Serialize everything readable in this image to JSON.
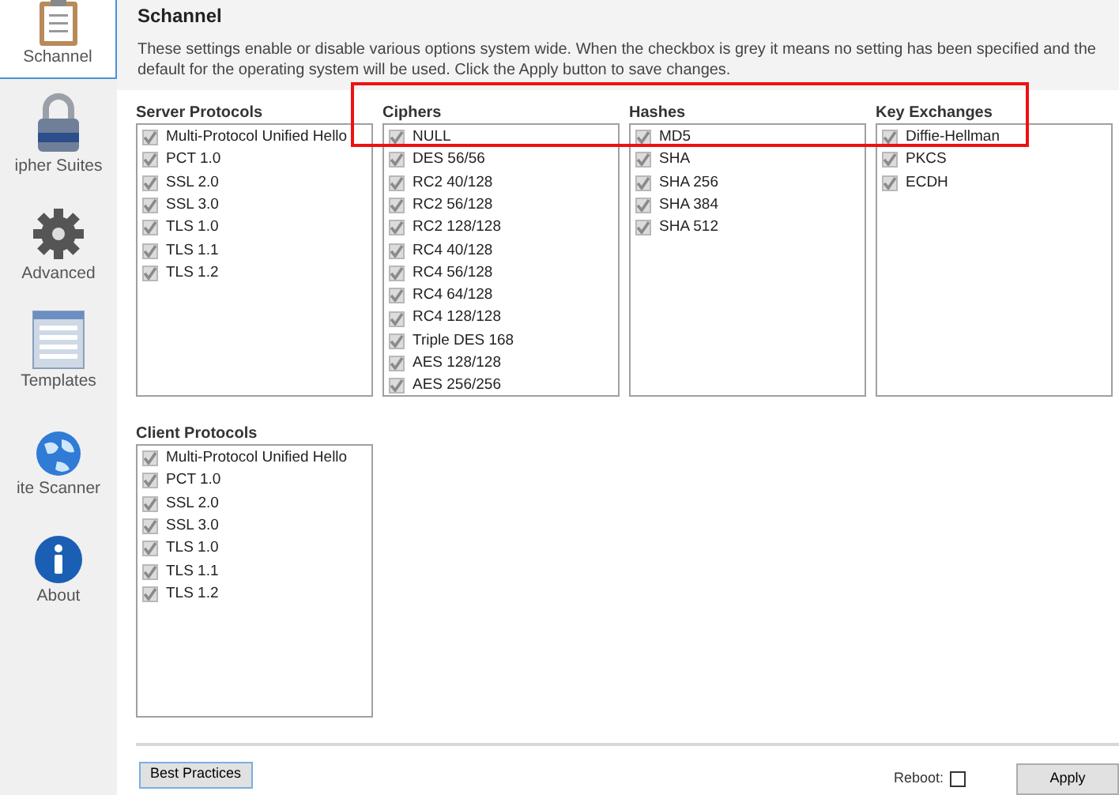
{
  "sidebar": {
    "items": [
      {
        "label": "Schannel",
        "selected": true
      },
      {
        "label": "ipher Suites",
        "selected": false
      },
      {
        "label": "Advanced",
        "selected": false
      },
      {
        "label": "Templates",
        "selected": false
      },
      {
        "label": "ite Scanner",
        "selected": false
      },
      {
        "label": "About",
        "selected": false
      }
    ]
  },
  "header": {
    "title": "Schannel",
    "description": "These settings enable or disable various options system wide. When the checkbox is grey it means no setting has been specified and the default for the operating system will be used. Click the Apply button to save changes."
  },
  "groups": [
    {
      "title": "Server Protocols",
      "items": [
        {
          "label": "Multi-Protocol Unified Hello",
          "checked": true,
          "greyed": true
        },
        {
          "label": "PCT 1.0",
          "checked": true,
          "greyed": true
        },
        {
          "label": "SSL 2.0",
          "checked": true,
          "greyed": true
        },
        {
          "label": "SSL 3.0",
          "checked": true,
          "greyed": true
        },
        {
          "label": "TLS 1.0",
          "checked": true,
          "greyed": true
        },
        {
          "label": "TLS 1.1",
          "checked": true,
          "greyed": true
        },
        {
          "label": "TLS 1.2",
          "checked": true,
          "greyed": true
        }
      ]
    },
    {
      "title": "Ciphers",
      "items": [
        {
          "label": "NULL",
          "checked": true,
          "greyed": true
        },
        {
          "label": "DES 56/56",
          "checked": true,
          "greyed": true
        },
        {
          "label": "RC2 40/128",
          "checked": true,
          "greyed": true
        },
        {
          "label": "RC2 56/128",
          "checked": true,
          "greyed": true
        },
        {
          "label": "RC2 128/128",
          "checked": true,
          "greyed": true
        },
        {
          "label": "RC4 40/128",
          "checked": true,
          "greyed": true
        },
        {
          "label": "RC4 56/128",
          "checked": true,
          "greyed": true
        },
        {
          "label": "RC4 64/128",
          "checked": true,
          "greyed": true
        },
        {
          "label": "RC4 128/128",
          "checked": true,
          "greyed": true
        },
        {
          "label": "Triple DES 168",
          "checked": true,
          "greyed": true
        },
        {
          "label": "AES 128/128",
          "checked": true,
          "greyed": true
        },
        {
          "label": "AES 256/256",
          "checked": true,
          "greyed": true
        }
      ]
    },
    {
      "title": "Hashes",
      "items": [
        {
          "label": "MD5",
          "checked": true,
          "greyed": true
        },
        {
          "label": "SHA",
          "checked": true,
          "greyed": true
        },
        {
          "label": "SHA 256",
          "checked": true,
          "greyed": true
        },
        {
          "label": "SHA 384",
          "checked": true,
          "greyed": true
        },
        {
          "label": "SHA 512",
          "checked": true,
          "greyed": true
        }
      ]
    },
    {
      "title": "Key Exchanges",
      "items": [
        {
          "label": "Diffie-Hellman",
          "checked": true,
          "greyed": true
        },
        {
          "label": "PKCS",
          "checked": true,
          "greyed": true
        },
        {
          "label": "ECDH",
          "checked": true,
          "greyed": true
        }
      ]
    },
    {
      "title": "Client Protocols",
      "items": [
        {
          "label": "Multi-Protocol Unified Hello",
          "checked": true,
          "greyed": true
        },
        {
          "label": "PCT 1.0",
          "checked": true,
          "greyed": true
        },
        {
          "label": "SSL 2.0",
          "checked": true,
          "greyed": true
        },
        {
          "label": "SSL 3.0",
          "checked": true,
          "greyed": true
        },
        {
          "label": "TLS 1.0",
          "checked": true,
          "greyed": true
        },
        {
          "label": "TLS 1.1",
          "checked": true,
          "greyed": true
        },
        {
          "label": "TLS 1.2",
          "checked": true,
          "greyed": true
        }
      ]
    }
  ],
  "footer": {
    "best_practices": "Best Practices",
    "reboot": {
      "label": "Reboot:",
      "checked": false
    },
    "apply": "Apply"
  }
}
